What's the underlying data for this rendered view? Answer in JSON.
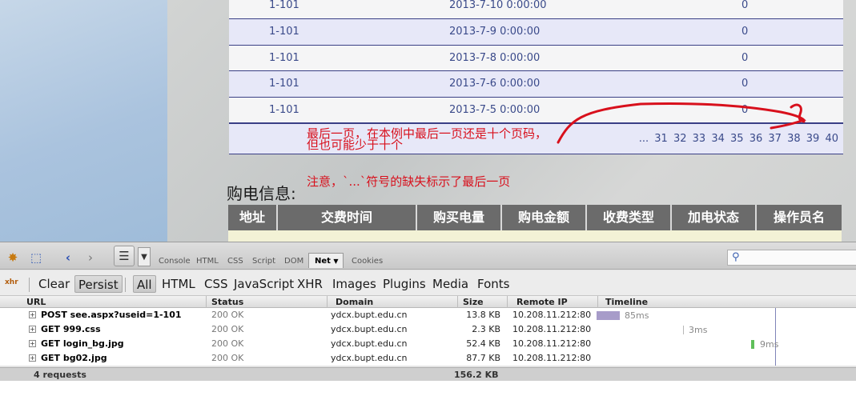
{
  "page": {
    "rows": [
      {
        "id": "1-101",
        "time": "2013-7-10 0:00:00",
        "value": "0"
      },
      {
        "id": "1-101",
        "time": "2013-7-9 0:00:00",
        "value": "0"
      },
      {
        "id": "1-101",
        "time": "2013-7-8 0:00:00",
        "value": "0"
      },
      {
        "id": "1-101",
        "time": "2013-7-6 0:00:00",
        "value": "0"
      },
      {
        "id": "1-101",
        "time": "2013-7-5 0:00:00",
        "value": "0"
      }
    ],
    "pager": [
      "...",
      "31",
      "32",
      "33",
      "34",
      "35",
      "36",
      "37",
      "38",
      "39",
      "40"
    ],
    "annotation_last_page": "最后一页，在本例中最后一页还是十个页码，但也可能少于十个",
    "annotation_note": "注意，`...`符号的缺失标示了最后一页",
    "section_title": "购电信息:",
    "buy_headers": [
      "地址",
      "交费时间",
      "购买电量",
      "购电金额",
      "收费类型",
      "加电状态",
      "操作员名"
    ],
    "annotation_color": "#d8101c"
  },
  "firebug": {
    "panel_tabs": [
      "Console",
      "HTML",
      "CSS",
      "Script",
      "DOM",
      "Net",
      "Cookies"
    ],
    "active_panel": "Net",
    "filter_buttons": {
      "clear": "Clear",
      "persist": "Persist"
    },
    "filter_tabs": [
      "All",
      "HTML",
      "CSS",
      "JavaScript",
      "XHR",
      "Images",
      "Plugins",
      "Media",
      "Fonts"
    ],
    "active_filter": "All",
    "columns": {
      "url": "URL",
      "status": "Status",
      "domain": "Domain",
      "size": "Size",
      "remote_ip": "Remote IP",
      "timeline": "Timeline"
    },
    "requests": [
      {
        "url": "POST see.aspx?useid=1-101",
        "status": "200 OK",
        "domain": "ydcx.bupt.edu.cn",
        "size": "13.8 KB",
        "ip": "10.208.11.212:80",
        "time": "85ms",
        "bar_color": "#a79cc9"
      },
      {
        "url": "GET 999.css",
        "status": "200 OK",
        "domain": "ydcx.bupt.edu.cn",
        "size": "2.3 KB",
        "ip": "10.208.11.212:80",
        "time": "3ms",
        "bar_color": "#b8b8b8"
      },
      {
        "url": "GET login_bg.jpg",
        "status": "200 OK",
        "domain": "ydcx.bupt.edu.cn",
        "size": "52.4 KB",
        "ip": "10.208.11.212:80",
        "time": "9ms",
        "bar_color": "#5fbf5a"
      },
      {
        "url": "GET bg02.jpg",
        "status": "200 OK",
        "domain": "ydcx.bupt.edu.cn",
        "size": "87.7 KB",
        "ip": "10.208.11.212:80",
        "time": "",
        "bar_color": ""
      }
    ],
    "footer": {
      "count": "4 requests",
      "total_size": "156.2 KB"
    }
  }
}
